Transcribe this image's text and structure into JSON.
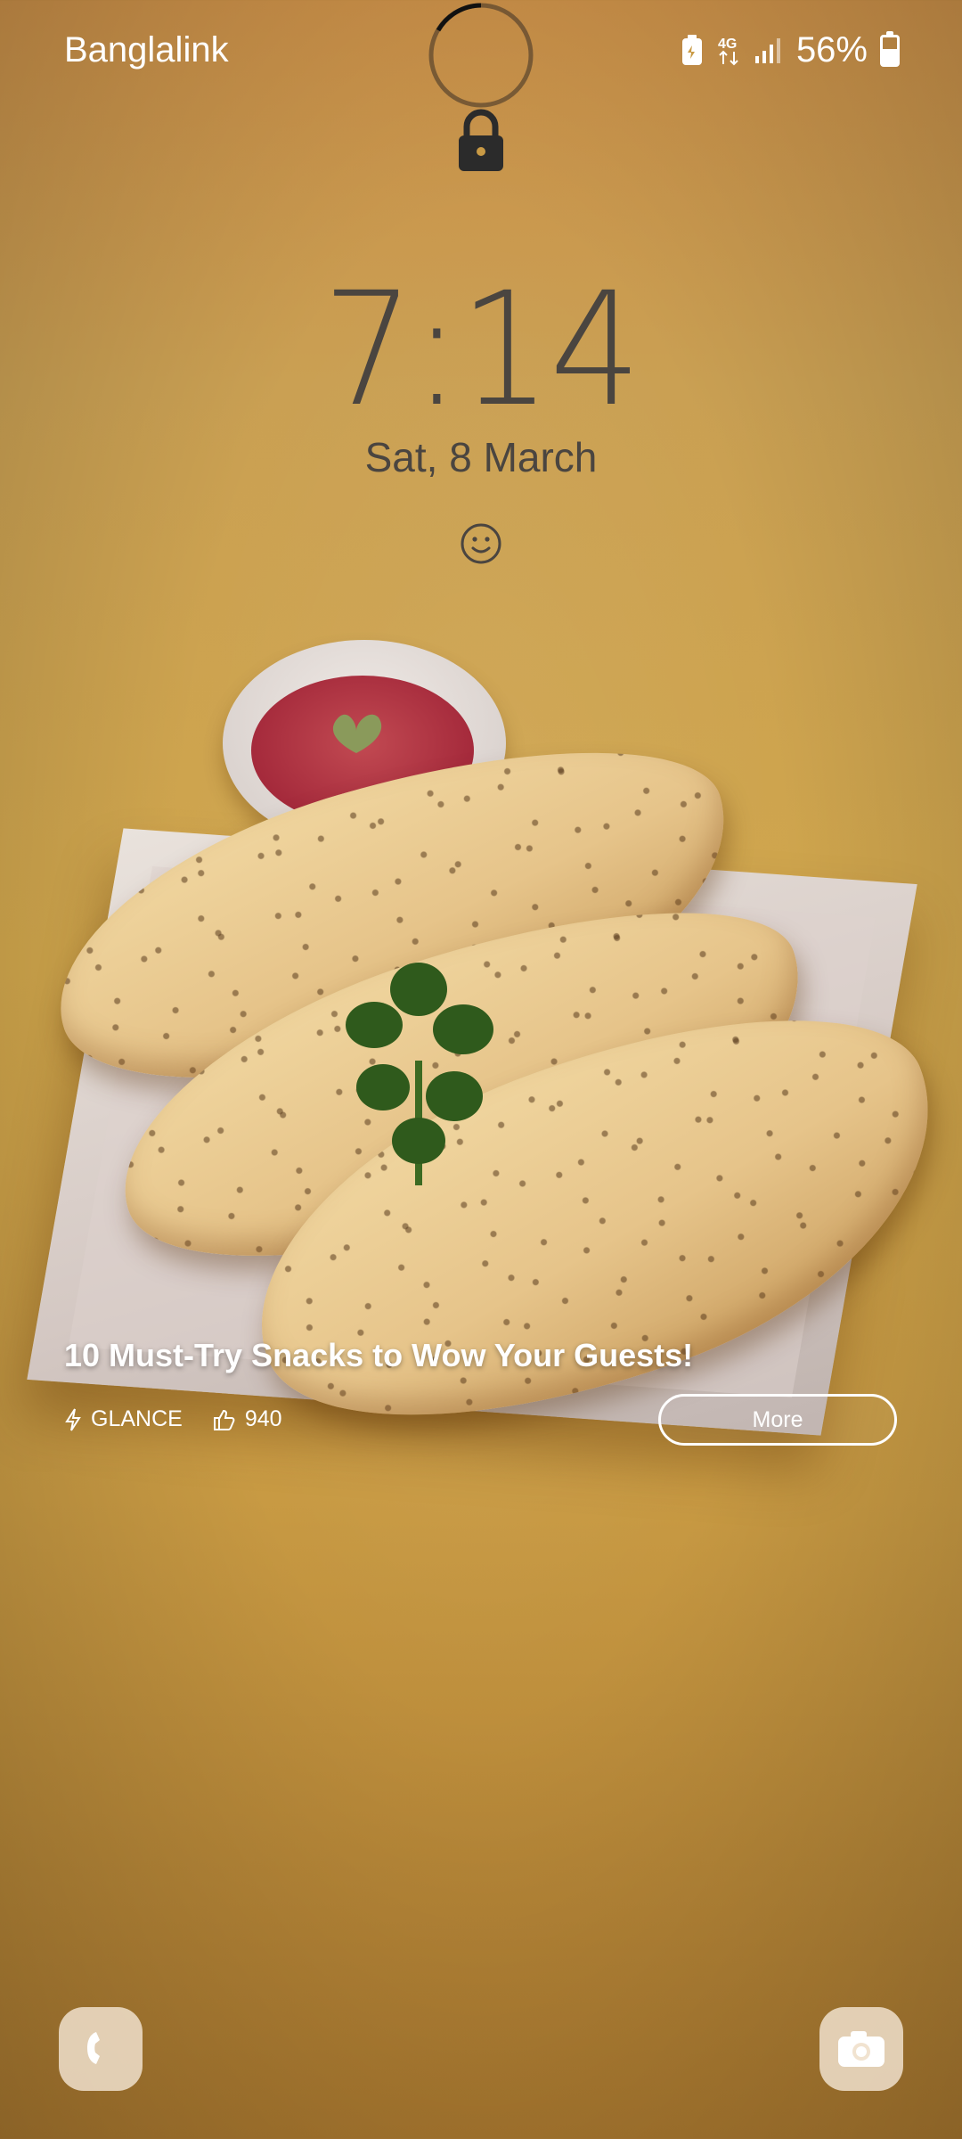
{
  "status_bar": {
    "carrier": "Banglalink",
    "battery_text": "56%",
    "battery_level": 0.56,
    "icons": [
      "battery-saver-icon",
      "4g-data-icon",
      "signal-icon",
      "battery-icon"
    ]
  },
  "lock_screen": {
    "time": "7:14",
    "date": "Sat, 8 March",
    "lock_icon": "lock-icon",
    "emoji_icon": "smiley-icon"
  },
  "glance": {
    "headline": "10 Must-Try Snacks to Wow Your Guests!",
    "source": "GLANCE",
    "likes": "940",
    "more_label": "More"
  },
  "shortcuts": {
    "left": "phone-icon",
    "right": "camera-icon"
  },
  "colors": {
    "background": "#c99a45",
    "clock_text": "#4a4540",
    "accent_text": "#ffffff"
  }
}
